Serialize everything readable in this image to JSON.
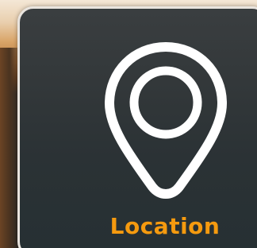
{
  "tile": {
    "label": "Location",
    "icon": "map-pin-icon"
  },
  "colors": {
    "label": "#f59a0f",
    "icon": "#ffffff",
    "tile_background": "#2b3235",
    "tile_border": "#e9e4de"
  }
}
